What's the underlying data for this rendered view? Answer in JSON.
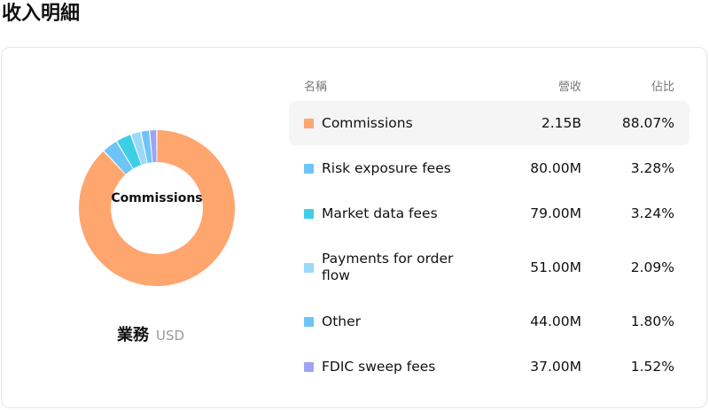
{
  "page": {
    "title": "收入明細"
  },
  "segment": {
    "title": "業務",
    "currency": "USD"
  },
  "donut": {
    "center_label": "Commissions"
  },
  "table": {
    "headers": {
      "name": "名稱",
      "revenue": "營收",
      "share": "佔比"
    },
    "rows": [
      {
        "name": "Commissions",
        "revenue": "2.15B",
        "share": "88.07%",
        "percent": 88.07,
        "color": "#FFA56E",
        "highlight": true
      },
      {
        "name": "Risk exposure fees",
        "revenue": "80.00M",
        "share": "3.28%",
        "percent": 3.28,
        "color": "#6EC4F7",
        "highlight": false
      },
      {
        "name": "Market data fees",
        "revenue": "79.00M",
        "share": "3.24%",
        "percent": 3.24,
        "color": "#3ECFE6",
        "highlight": false
      },
      {
        "name": "Payments for order flow",
        "revenue": "51.00M",
        "share": "2.09%",
        "percent": 2.09,
        "color": "#9BD9F8",
        "highlight": false
      },
      {
        "name": "Other",
        "revenue": "44.00M",
        "share": "1.80%",
        "percent": 1.8,
        "color": "#6EC4F7",
        "highlight": false
      },
      {
        "name": "FDIC sweep fees",
        "revenue": "37.00M",
        "share": "1.52%",
        "percent": 1.52,
        "color": "#9EA4F4",
        "highlight": false
      }
    ]
  }
}
